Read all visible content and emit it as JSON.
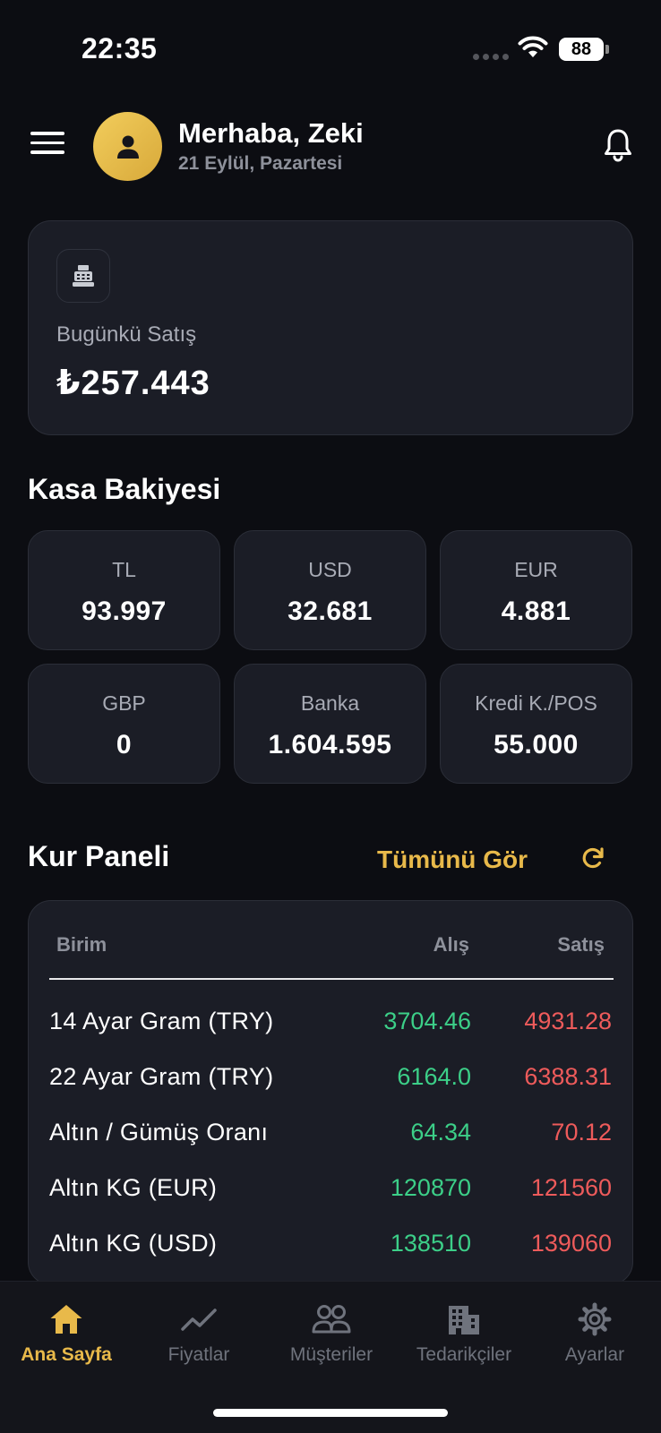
{
  "status_bar": {
    "time": "22:35",
    "battery": "88"
  },
  "header": {
    "greeting": "Merhaba, Zeki",
    "date": "21 Eylül, Pazartesi"
  },
  "sales": {
    "label": "Bugünkü Satış",
    "value": "₺257.443"
  },
  "balance": {
    "title": "Kasa Bakiyesi",
    "items": [
      {
        "label": "TL",
        "value": "93.997"
      },
      {
        "label": "USD",
        "value": "32.681"
      },
      {
        "label": "EUR",
        "value": "4.881"
      },
      {
        "label": "GBP",
        "value": "0"
      },
      {
        "label": "Banka",
        "value": "1.604.595"
      },
      {
        "label": "Kredi K./POS",
        "value": "55.000"
      }
    ]
  },
  "rates": {
    "title": "Kur Paneli",
    "see_all": "Tümünü Gör",
    "columns": {
      "unit": "Birim",
      "buy": "Alış",
      "sell": "Satış"
    },
    "rows": [
      {
        "name": "14 Ayar Gram (TRY)",
        "buy": "3704.46",
        "sell": "4931.28"
      },
      {
        "name": "22 Ayar Gram (TRY)",
        "buy": "6164.0",
        "sell": "6388.31"
      },
      {
        "name": "Altın / Gümüş Oranı",
        "buy": "64.34",
        "sell": "70.12"
      },
      {
        "name": "Altın KG (EUR)",
        "buy": "120870",
        "sell": "121560"
      },
      {
        "name": "Altın KG (USD)",
        "buy": "138510",
        "sell": "139060"
      }
    ]
  },
  "tabs": [
    {
      "label": "Ana Sayfa",
      "icon": "home-icon",
      "active": true
    },
    {
      "label": "Fiyatlar",
      "icon": "chart-line-icon",
      "active": false
    },
    {
      "label": "Müşteriler",
      "icon": "users-icon",
      "active": false
    },
    {
      "label": "Tedarikçiler",
      "icon": "building-icon",
      "active": false
    },
    {
      "label": "Ayarlar",
      "icon": "gear-icon",
      "active": false
    }
  ],
  "colors": {
    "accent": "#e8b94a",
    "buy": "#3ccf88",
    "sell": "#ee5b5b",
    "card": "#1b1d26",
    "background": "#0c0d12"
  }
}
